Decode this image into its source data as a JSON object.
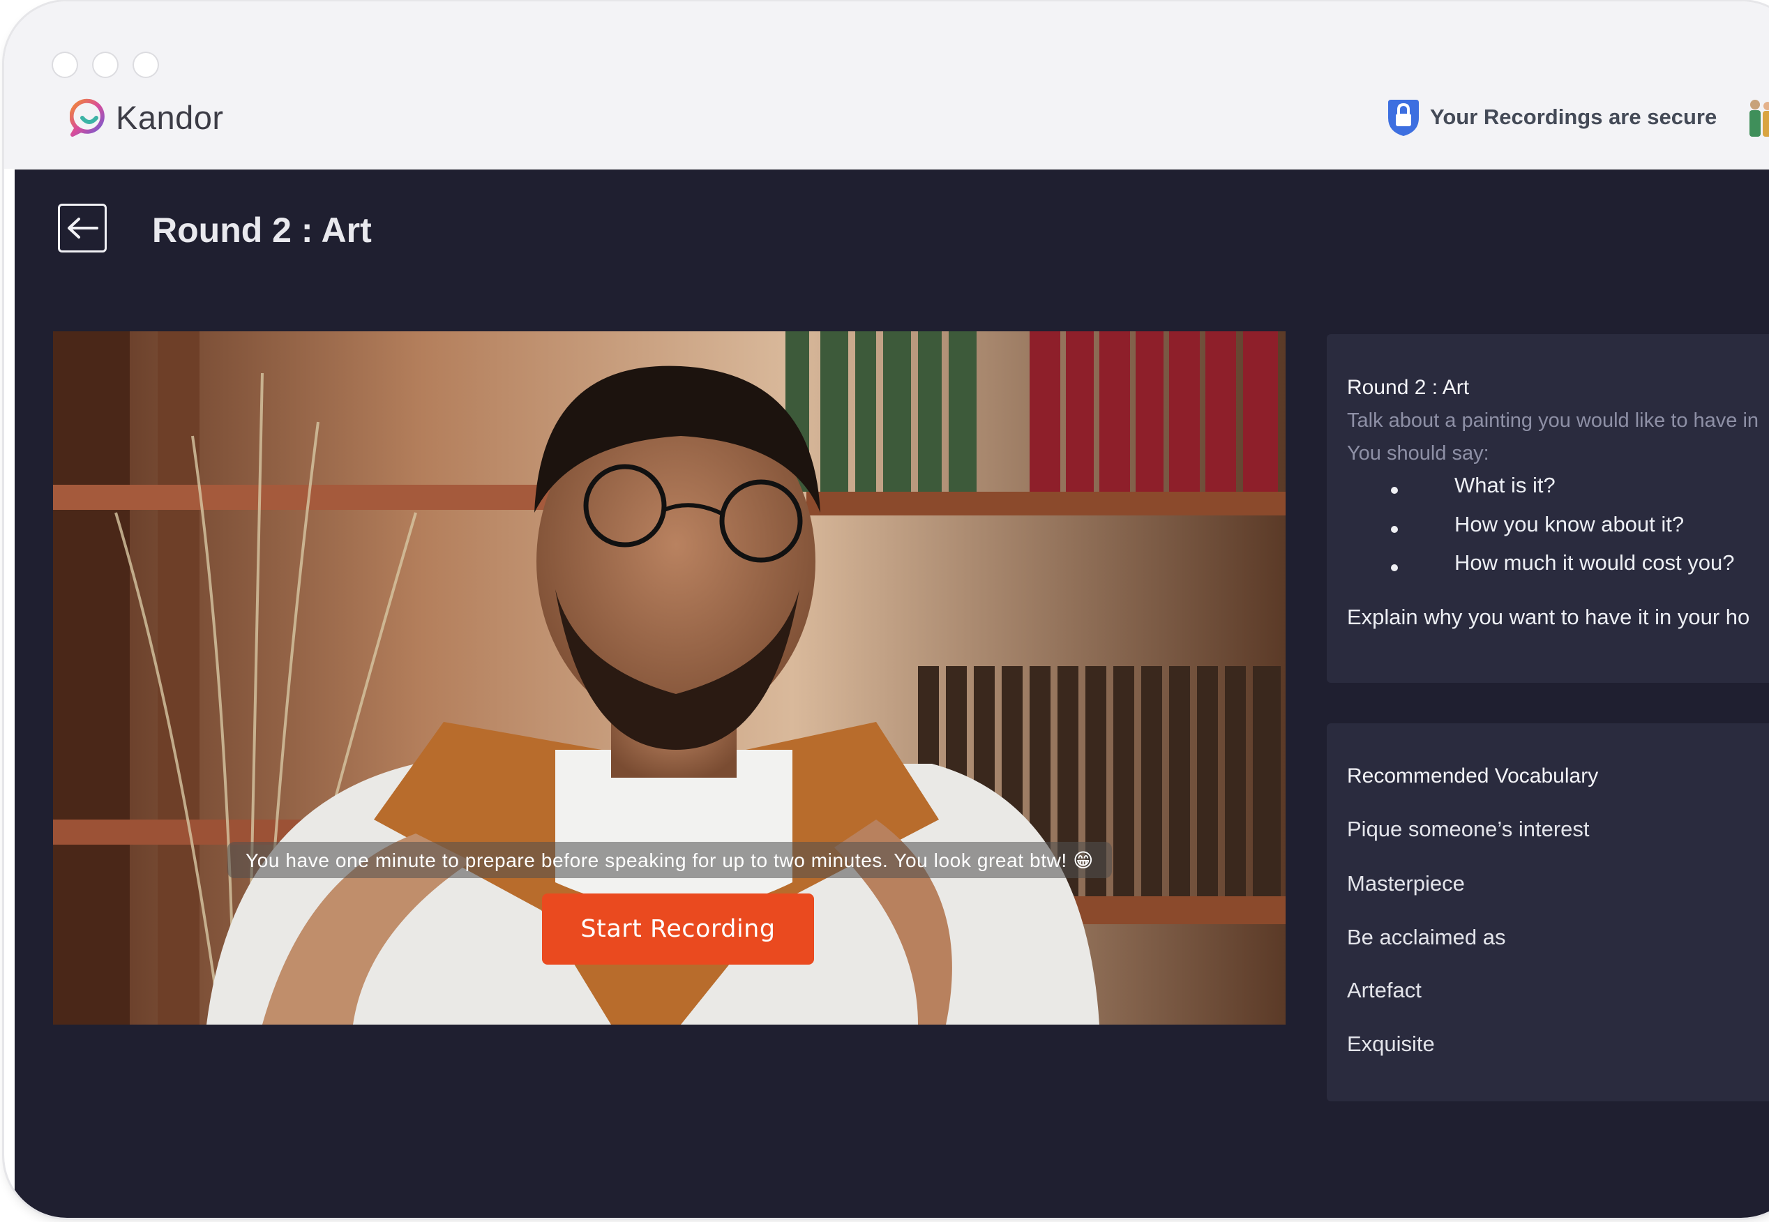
{
  "window": {
    "controls": [
      "close",
      "minimize",
      "maximize"
    ]
  },
  "header": {
    "brand": "Kandor",
    "security_text": "Your Recordings are secure",
    "security_icon": "lock-icon"
  },
  "page": {
    "title": "Round 2 : Art",
    "back_icon": "arrow-left-icon"
  },
  "video": {
    "caption": "You have one minute to prepare before speaking for up to two minutes. You look great btw! 😁",
    "start_label": "Start Recording",
    "start_color": "#ea4a1f"
  },
  "topic_card": {
    "title": "Round 2 : Art",
    "prompt": "Talk about a painting you would like to have in",
    "instruction": "You should say:",
    "bullets": [
      "What is it?",
      "How you know about it?",
      "How much it would cost you?"
    ],
    "closing": "Explain why you want to have it in your ho"
  },
  "vocab_card": {
    "heading": "Recommended Vocabulary",
    "items": [
      "Pique someone’s interest",
      "Masterpiece",
      "Be acclaimed as",
      "Artefact",
      "Exquisite"
    ]
  },
  "colors": {
    "app_background": "#1f1f30",
    "panel_background": "#2a2b3e",
    "titlebar": "#f3f3f6",
    "accent": "#ea4a1f",
    "security_blue": "#3d6fe0"
  }
}
